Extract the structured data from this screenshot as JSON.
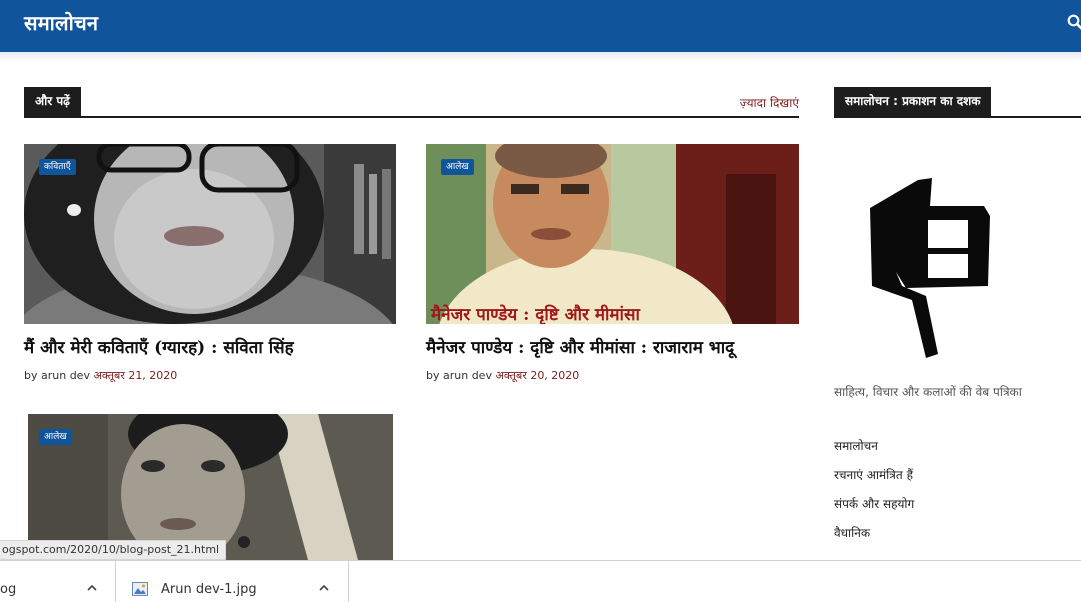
{
  "header": {
    "site_title": "समालोचन",
    "brand_color": "#10549c"
  },
  "more_posts": {
    "heading": "और पढ़ें",
    "more_link": "ज़्यादा दिखाएं"
  },
  "posts": [
    {
      "category": "कविताएँ",
      "title": "मैं और मेरी कविताएँ (ग्यारह) : सविता सिंह",
      "by": "by",
      "author": "arun dev",
      "date": "अक्तूबर 21, 2020"
    },
    {
      "category": "आलेख",
      "title": "मैनेजर पाण्डेय : दृष्टि और मीमांसा : राजाराम भादू",
      "image_caption": "मैनेजर पाण्डेय : दृष्टि और मीमांसा",
      "by": "by",
      "author": "arun dev",
      "date": "अक्तूबर 20, 2020"
    },
    {
      "category": "आलेख"
    }
  ],
  "sidebar": {
    "heading": "समालोचन : प्रकाशन का दशक",
    "tagline": "साहित्य, विचार और कलाओं की वेब पत्रिका",
    "links": [
      "समालोचन",
      "रचनाएं आमंत्रित हैं",
      "संपर्क और सहयोग",
      "वैधानिक"
    ]
  },
  "status_bar": {
    "url": "ogspot.com/2020/10/blog-post_21.html"
  },
  "downloads": [
    {
      "name": "og"
    },
    {
      "name": "Arun dev-1.jpg"
    }
  ],
  "icons": {
    "search": "search-icon",
    "file": "image-file-icon",
    "chevron": "chevron-up-icon"
  }
}
